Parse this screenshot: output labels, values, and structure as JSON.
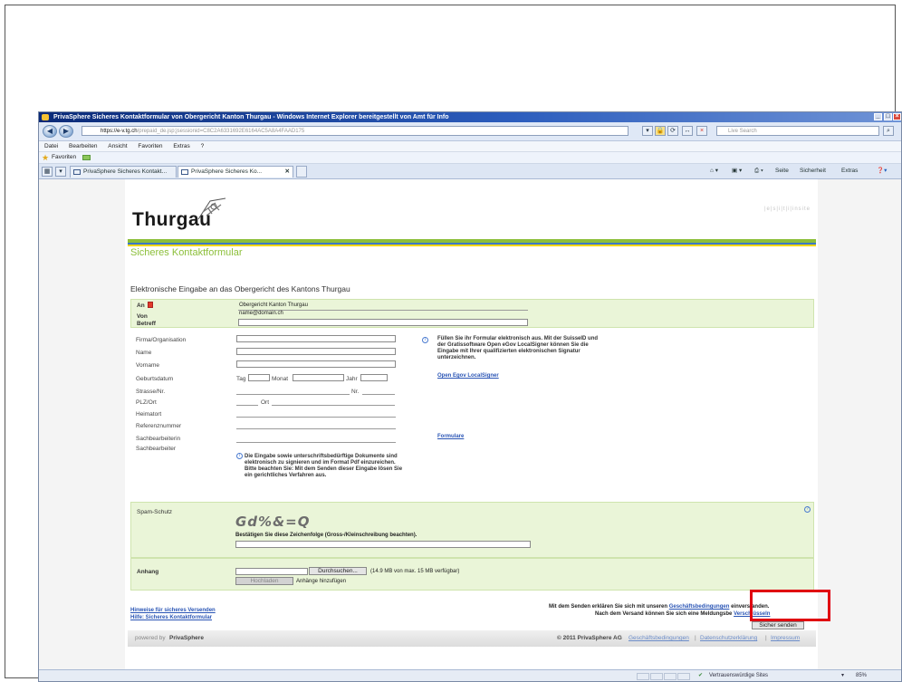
{
  "browser": {
    "title": "PrivaSphere Sicheres Kontaktformular von Obergericht Kanton Thurgau - Windows Internet Explorer bereitgestellt von Amt für Info",
    "url_prefix": "https://",
    "url_domain": "e-v.tg.ch",
    "url_rest": "/prepaid_de.jsp;jsessionid=C8C2A6331692E6164AC5A8A4FAAD175",
    "search_placeholder": "Live Search",
    "menu": [
      "Datei",
      "Bearbeiten",
      "Ansicht",
      "Favoriten",
      "Extras",
      "?"
    ],
    "favorites_label": "Favoriten",
    "tabs": [
      "PrivaSphere Sicheres Kontakt...",
      "PrivaSphere Sicheres Ko..."
    ],
    "command_bar": {
      "page": "Seite",
      "safety": "Sicherheit",
      "extras": "Extras"
    },
    "status": {
      "zone": "Vertrauenswürdige Sites",
      "zoom": "85%"
    }
  },
  "header": {
    "logo_text": "Thurgau",
    "brand_links": "|e|s|i|t|i|insite",
    "subtitle": "Sicheres Kontaktformular"
  },
  "form": {
    "heading": "Elektronische Eingabe an das Obergericht des Kantons Thurgau",
    "an_label": "An",
    "an_value": "Obergericht Kanton Thurgau",
    "von_label": "Von",
    "von_value": "name@domain.ch",
    "betreff_label": "Betreff",
    "fields": {
      "firma": "Firma/Organisation",
      "name": "Name",
      "vorname": "Vorname",
      "geburtsdatum": "Geburtsdatum",
      "strasse": "Strasse/Nr.",
      "plz": "PLZ/Ort",
      "heimatort": "Heimatort",
      "referenz": "Referenznummer",
      "sachbearbeiterin": "Sachbearbeiterin",
      "sachbearbeiter": "Sachbearbeiter"
    },
    "date_parts": {
      "tag": "Tag",
      "monat": "Monat",
      "jahr": "Jahr"
    },
    "nr_label": "Nr.",
    "ort_label": "Ort",
    "signature_note": "Füllen Sie ihr Formular elektronisch aus. Mit der SuisseID und der Gratissoftware Open eGov LocalSigner können Sie die Eingabe mit Ihrer qualifizierten elektronischen Signatur unterzeichnen.",
    "localsigner_link": "Open Egov LocalSigner",
    "formulare_link": "Formulare",
    "upload_note": "Die Eingabe sowie unterschriftsbedürftige Dokumente sind elektronisch zu signieren und im Format Pdf einzureichen. Bitte beachten Sie: Mit dem Senden dieser Eingabe lösen Sie ein gerichtliches Verfahren aus."
  },
  "spam": {
    "label": "Spam-Schutz",
    "captcha": "Gd%&=Q",
    "instruction": "Bestätigen Sie diese Zeichenfolge (Gross-/Kleinschreibung beachten)."
  },
  "attachments": {
    "label": "Anhang",
    "browse_button": "Durchsuchen...",
    "quota": "(14.9 MB von max. 15 MB verfügbar)",
    "upload_button": "Hochladen",
    "add_label": "Anhänge hinzufügen"
  },
  "legal": {
    "line1_pre": "Mit dem Senden erklären Sie sich mit unseren",
    "line1_link": "Geschäftsbedingungen",
    "line1_post": "einverstanden.",
    "line2_pre": "Nach dem Versand können Sie sich eine Meldungsbe",
    "line2_link": "Verschlüsseln",
    "send_button": "Sicher senden"
  },
  "help_links": [
    "Hinweise für sicheres Versenden",
    "Hilfe: Sicheres Kontaktformular"
  ],
  "footer": {
    "powered": "powered by",
    "brand": "PrivaSphere",
    "copyright": "© 2011 PrivaSphere AG",
    "links": [
      "Geschäftsbedingungen",
      "Datenschutzerklärung",
      "Impressum"
    ],
    "sep": "|"
  },
  "colors": {
    "accent_green": "#8cbf3a",
    "brand_blue": "#2c5dbd",
    "highlight": "#e00010"
  }
}
